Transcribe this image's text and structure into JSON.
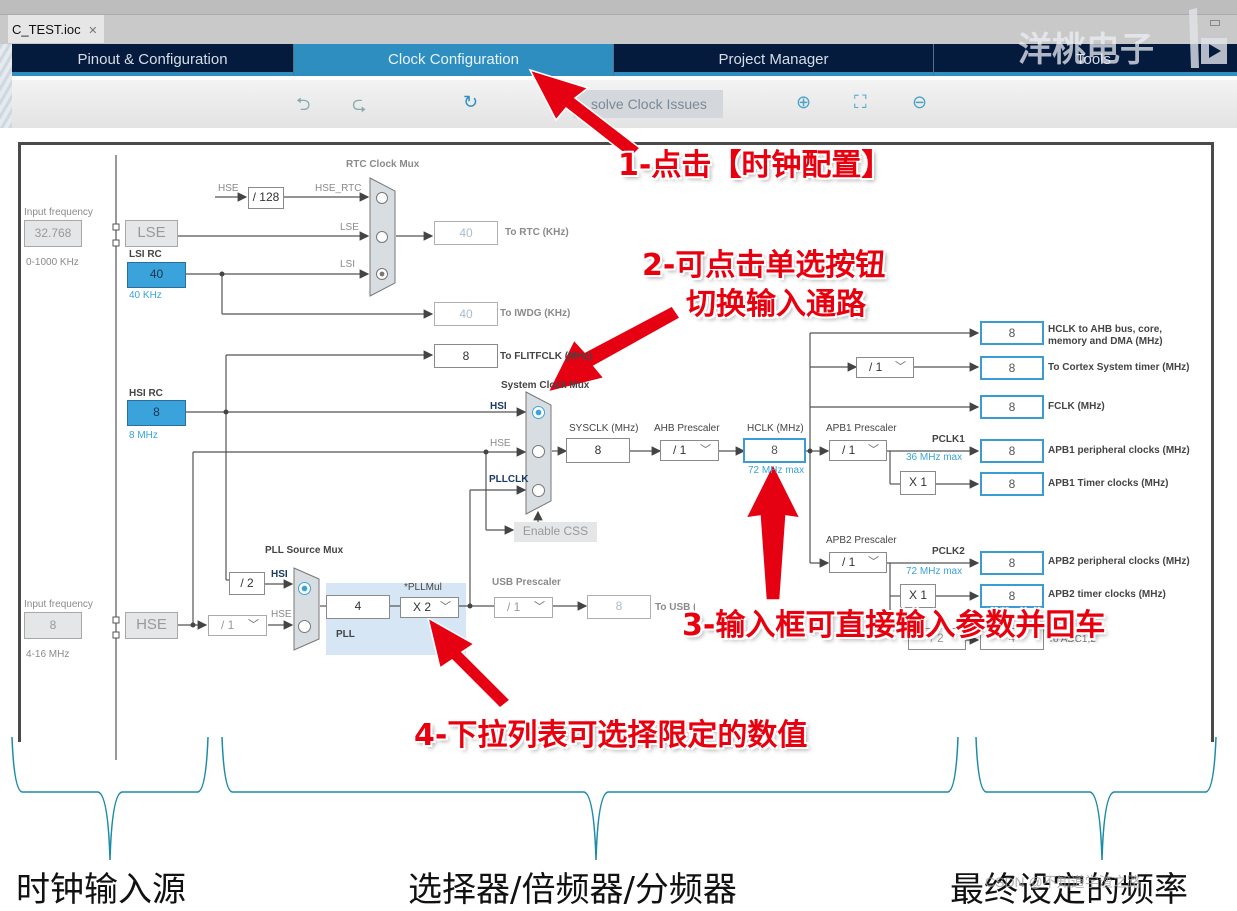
{
  "window": {
    "file_tab": "C_TEST.ioc",
    "file_tab_close_icon": "close-icon",
    "watermark": "洋桃电子"
  },
  "nav": {
    "tabs": [
      {
        "label": "Pinout & Configuration",
        "active": false
      },
      {
        "label": "Clock Configuration",
        "active": true
      },
      {
        "label": "Project Manager",
        "active": false
      },
      {
        "label": "Tools",
        "active": false
      }
    ]
  },
  "toolbar": {
    "undo_icon": "undo-icon",
    "redo_icon": "redo-icon",
    "reset_icon": "refresh-icon",
    "resolve_label": "Resolve Clock Issues",
    "resolve_visible": "solve Clock Issues",
    "zoom_in_icon": "zoom-in-icon",
    "fit_icon": "fit-screen-icon",
    "zoom_out_icon": "zoom-out-icon"
  },
  "diagram": {
    "lse_input": {
      "label": "Input frequency",
      "value": "32.768",
      "range": "0-1000 KHz"
    },
    "lse": {
      "label": "LSE"
    },
    "lsi": {
      "label": "LSI RC",
      "value": "40",
      "unit": "40 KHz"
    },
    "rtc_mux": {
      "title": "RTC Clock Mux",
      "hse_in": "HSE",
      "div128": "/ 128",
      "inputs": [
        "HSE_RTC",
        "LSE",
        "LSI"
      ],
      "selected": "LSI"
    },
    "to_rtc": {
      "value": "40",
      "label": "To RTC (KHz)"
    },
    "to_iwdg": {
      "value": "40",
      "label": "To IWDG (KHz)"
    },
    "to_flitfclk": {
      "value": "8",
      "label": "To FLITFCLK (MHz)"
    },
    "hsi": {
      "label": "HSI RC",
      "value": "8",
      "unit": "8 MHz"
    },
    "sysclk_mux": {
      "title": "System Clock Mux",
      "inputs": [
        "HSI",
        "HSE",
        "PLLCLK"
      ],
      "selected": "HSI"
    },
    "enable_css": "Enable CSS",
    "sysclk": {
      "label": "SYSCLK (MHz)",
      "value": "8"
    },
    "ahb_prescaler": {
      "label": "AHB Prescaler",
      "value": "/ 1"
    },
    "hclk": {
      "label": "HCLK (MHz)",
      "value": "8",
      "max": "72 MHz max"
    },
    "apb1_prescaler": {
      "label": "APB1 Prescaler",
      "value": "/ 1",
      "pclk": "PCLK1",
      "max": "36 MHz max",
      "timer_mul": "X 1"
    },
    "apb2_prescaler": {
      "label": "APB2 Prescaler",
      "value": "/ 1",
      "pclk": "PCLK2",
      "max": "72 MHz max",
      "timer_mul": "X 1"
    },
    "adc_prescaler": {
      "value": "/ 2",
      "out_value": "4",
      "label": "To ADC1,2"
    },
    "outputs": [
      {
        "value": "8",
        "label": "HCLK to AHB bus, core, memory and DMA (MHz)"
      },
      {
        "value": "8",
        "label": "To Cortex System timer (MHz)"
      },
      {
        "value": "8",
        "label": "FCLK (MHz)"
      },
      {
        "value": "8",
        "label": "APB1 peripheral clocks (MHz)"
      },
      {
        "value": "8",
        "label": "APB1 Timer clocks (MHz)"
      },
      {
        "value": "8",
        "label": "APB2 peripheral clocks (MHz)"
      },
      {
        "value": "8",
        "label": "APB2 timer clocks (MHz)"
      }
    ],
    "cortex_div": "/ 1",
    "pll_mux": {
      "title": "PLL Source Mux",
      "hsi_div": "/ 2",
      "inputs": [
        "HSI",
        "HSE"
      ],
      "selected": "HSI"
    },
    "hse_input": {
      "label": "Input frequency",
      "value": "8",
      "range": "4-16 MHz"
    },
    "hse": {
      "label": "HSE"
    },
    "hse_prediv": "/ 1",
    "pll": {
      "label": "PLL",
      "value": "4",
      "mul_label": "*PLLMul",
      "mul": "X 2"
    },
    "usb": {
      "label": "USB Prescaler",
      "value": "/ 1",
      "out_value": "8",
      "out_label": "To USB (MHz)"
    }
  },
  "annotations": {
    "a1": "1-点击【时钟配置】",
    "a2_line1": "2-可点击单选按钮",
    "a2_line2": "切换输入通路",
    "a3": "3-输入框可直接输入参数并回车",
    "a4": "4-下拉列表可选择限定的数值"
  },
  "bottom_labels": {
    "left": "时钟输入源",
    "middle": "选择器/倍频器/分频器",
    "right": "最终设定的频率"
  },
  "credit": "CSDN @不知道学渣之路"
}
